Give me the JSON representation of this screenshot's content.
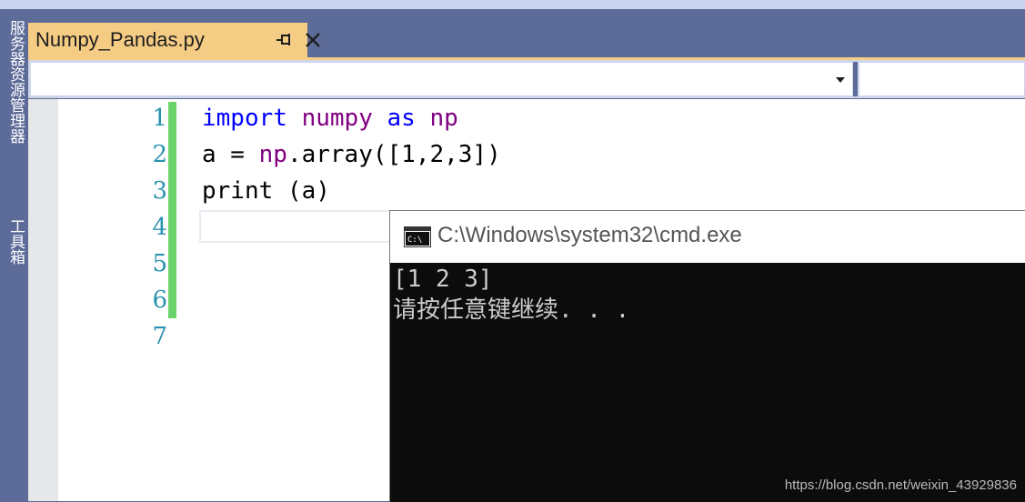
{
  "left_panel": {
    "tabs": [
      "服务器资源管理器",
      "工具箱"
    ]
  },
  "document_tab": {
    "filename": "Numpy_Pandas.py"
  },
  "editor": {
    "line_numbers": [
      "1",
      "2",
      "3",
      "4",
      "5",
      "6",
      "7"
    ],
    "lines": [
      [
        {
          "t": "import",
          "c": "kw"
        },
        {
          "t": " ",
          "c": ""
        },
        {
          "t": "numpy",
          "c": "mod"
        },
        {
          "t": " ",
          "c": ""
        },
        {
          "t": "as",
          "c": "kw"
        },
        {
          "t": " ",
          "c": ""
        },
        {
          "t": "np",
          "c": "mod"
        }
      ],
      [
        {
          "t": "a = ",
          "c": ""
        },
        {
          "t": "np",
          "c": "mod"
        },
        {
          "t": ".array([1,2,3])",
          "c": ""
        }
      ],
      [
        {
          "t": "print (a)",
          "c": ""
        }
      ]
    ]
  },
  "console": {
    "title": "C:\\Windows\\system32\\cmd.exe",
    "output": [
      "[1 2 3]",
      "请按任意键继续. . ."
    ]
  },
  "watermark": "https://blog.csdn.net/weixin_43929836",
  "colors": {
    "keyword": "#0000ff",
    "module": "#800080",
    "line_number": "#2b91af",
    "tab_active": "#f5cc84",
    "change_bar": "#6ad36a"
  },
  "icons": {
    "pin": "pin-icon",
    "close": "close-icon",
    "dropdown": "caret-down-icon",
    "console": "cmd-icon"
  }
}
